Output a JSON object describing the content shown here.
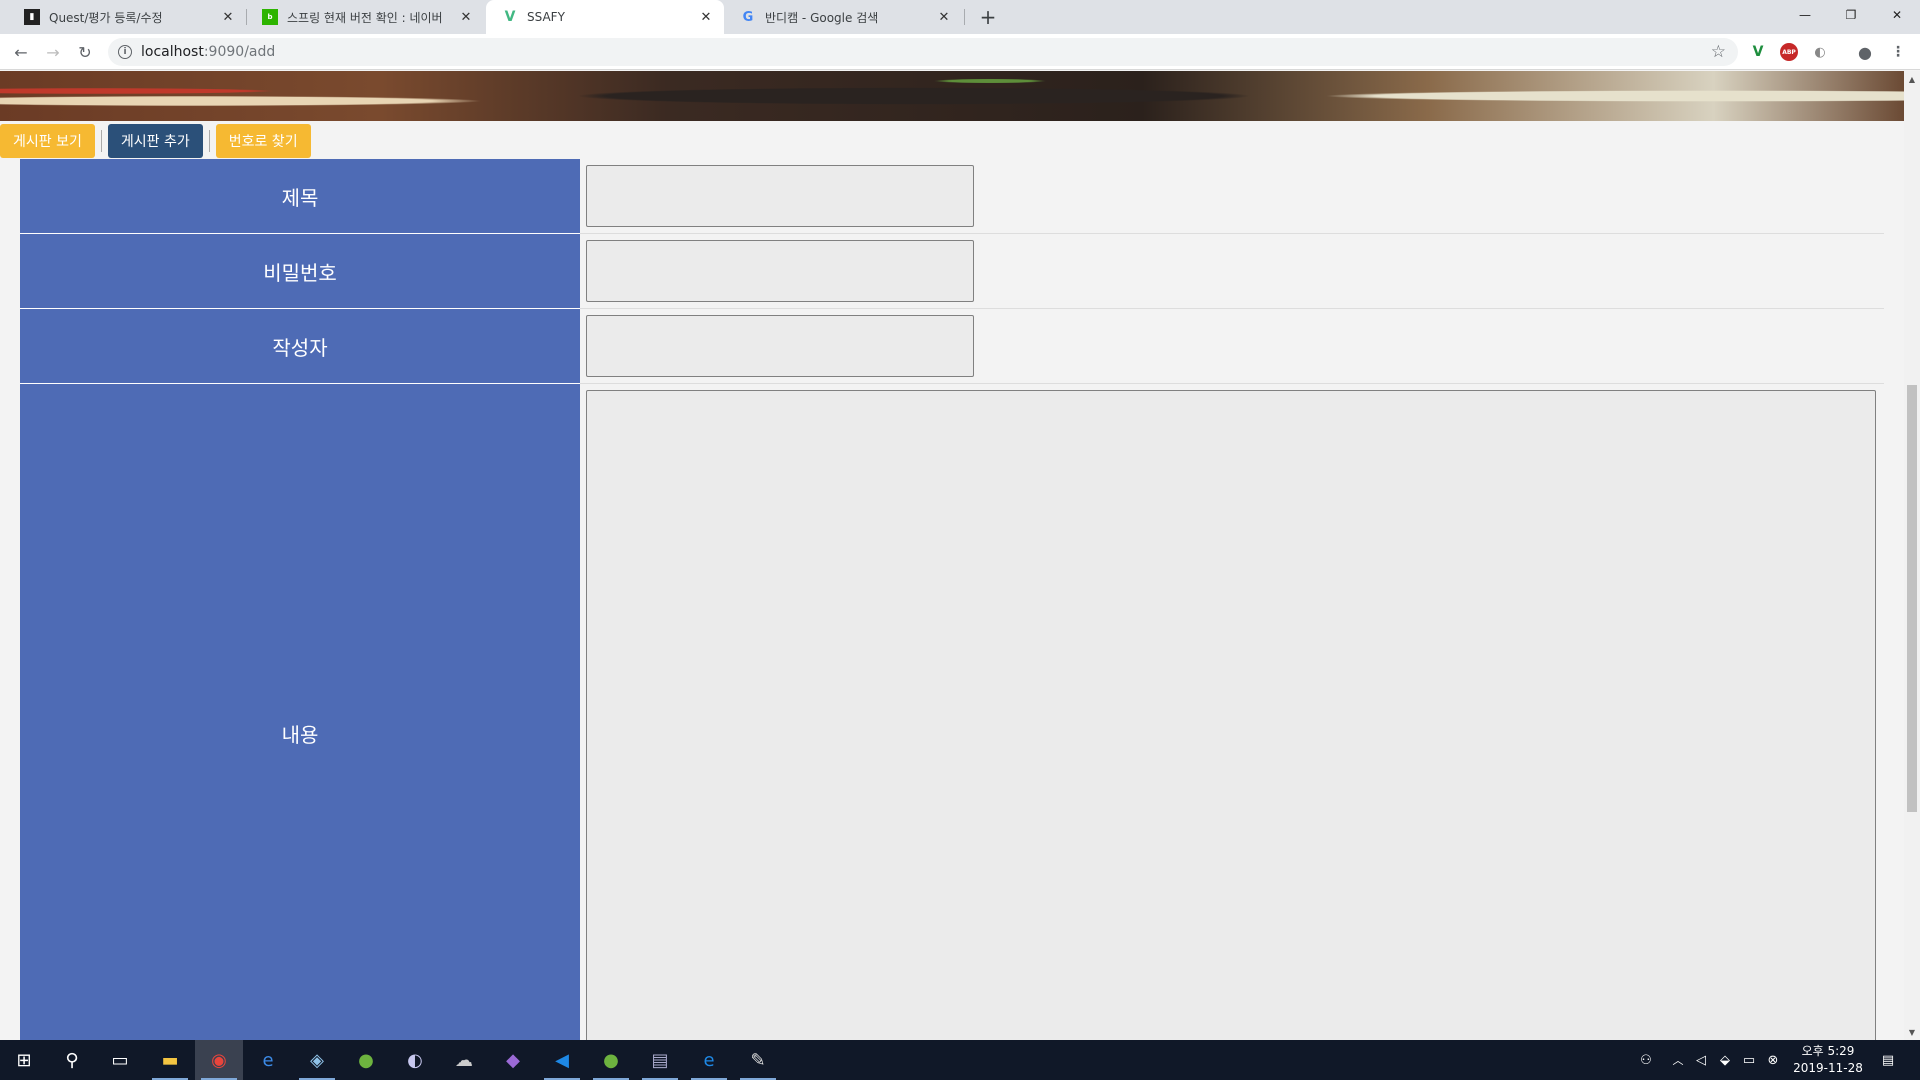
{
  "browser": {
    "tabs": [
      {
        "title": "Quest/평가 등록/수정",
        "favicon": "document-favicon-icon"
      },
      {
        "title": "스프링 현재 버전 확인 : 네이버",
        "favicon": "blog-favicon-icon"
      },
      {
        "title": "SSAFY",
        "favicon": "vue-favicon-icon",
        "active": true
      },
      {
        "title": "반디캠 - Google 검색",
        "favicon": "google-favicon-icon"
      }
    ],
    "new_tab": "+",
    "url_host": "localhost",
    "url_path": ":9090/add"
  },
  "menu": {
    "view_board": "게시판 보기",
    "add_board": "게시판 추가",
    "find_by_number": "번호로 찾기"
  },
  "form": {
    "title_label": "제목",
    "password_label": "비밀번호",
    "author_label": "작성자",
    "content_label": "내용",
    "title_value": "",
    "password_value": "",
    "author_value": "",
    "content_value": ""
  },
  "taskbar": {
    "time": "오후 5:29",
    "date": "2019-11-28"
  },
  "colors": {
    "label_bg": "#4e6bb5",
    "menu_yellow": "#f6b932",
    "menu_blue": "#2b5079",
    "taskbar_bg": "#101828"
  }
}
